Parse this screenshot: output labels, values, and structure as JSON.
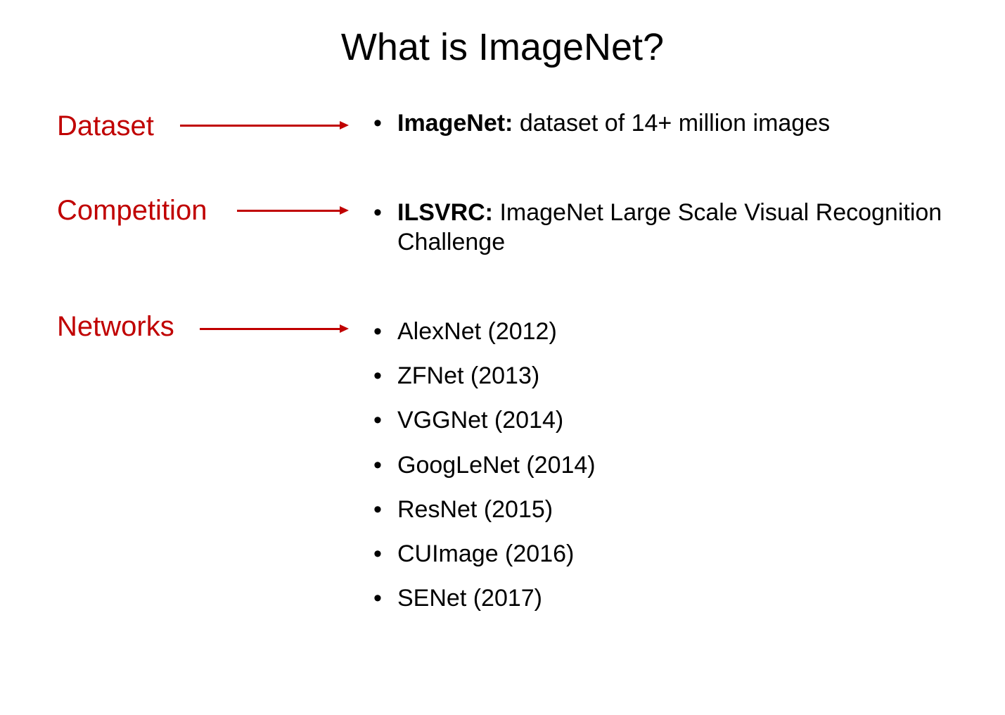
{
  "slide": {
    "title": "What is ImageNet?"
  },
  "colors": {
    "accent": "#c00000",
    "text": "#000000",
    "background": "#ffffff"
  },
  "sections": [
    {
      "label": "Dataset",
      "items": [
        {
          "bold": "ImageNet:",
          "text": " dataset of 14+ million images"
        }
      ]
    },
    {
      "label": "Competition",
      "items": [
        {
          "bold": "ILSVRC:",
          "text": " ImageNet Large Scale Visual Recognition Challenge"
        }
      ]
    },
    {
      "label": "Networks",
      "items": [
        {
          "bold": "",
          "text": "AlexNet (2012)"
        },
        {
          "bold": "",
          "text": "ZFNet (2013)"
        },
        {
          "bold": "",
          "text": "VGGNet (2014)"
        },
        {
          "bold": "",
          "text": "GoogLeNet (2014)"
        },
        {
          "bold": "",
          "text": "ResNet (2015)"
        },
        {
          "bold": "",
          "text": "CUImage (2016)"
        },
        {
          "bold": "",
          "text": "SENet (2017)"
        }
      ]
    }
  ],
  "bullet_glyph": "•"
}
